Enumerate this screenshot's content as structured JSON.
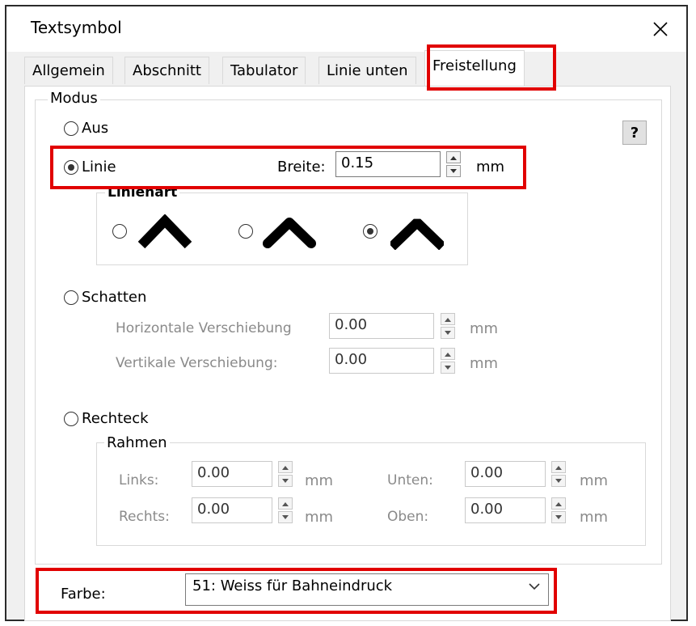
{
  "window": {
    "title": "Textsymbol"
  },
  "tabs": [
    {
      "label": "Allgemein"
    },
    {
      "label": "Abschnitt"
    },
    {
      "label": "Tabulator"
    },
    {
      "label": "Linie unten"
    },
    {
      "label": "Freistellung"
    }
  ],
  "active_tab": "Freistellung",
  "modus": {
    "title": "Modus",
    "help_label": "?",
    "aus_label": "Aus",
    "linie_label": "Linie",
    "breite_label": "Breite:",
    "breite_value": "0.15",
    "breite_unit": "mm",
    "linienart_title": "Linienart",
    "linienart_selected_index": 2,
    "schatten_label": "Schatten",
    "horiz_label": "Horizontale Verschiebung",
    "horiz_value": "0.00",
    "horiz_unit": "mm",
    "vert_label": "Vertikale Verschiebung:",
    "vert_value": "0.00",
    "vert_unit": "mm",
    "rechteck_label": "Rechteck",
    "rahmen_title": "Rahmen",
    "links_label": "Links:",
    "links_value": "0.00",
    "rechts_label": "Rechts:",
    "rechts_value": "0.00",
    "unten_label": "Unten:",
    "unten_value": "0.00",
    "oben_label": "Oben:",
    "oben_value": "0.00",
    "unit_mm": "mm",
    "selected_mode": "Linie"
  },
  "farbe": {
    "label": "Farbe:",
    "value": "51: Weiss für Bahneindruck"
  },
  "colors": {
    "highlight": "#e10000",
    "panel_bg": "#ffffff",
    "dialog_bg": "#f0f0f0"
  },
  "icons": {
    "close": "close-icon",
    "spin_up": "chevron-up-icon",
    "spin_down": "chevron-down-icon",
    "dropdown": "chevron-down-icon"
  }
}
